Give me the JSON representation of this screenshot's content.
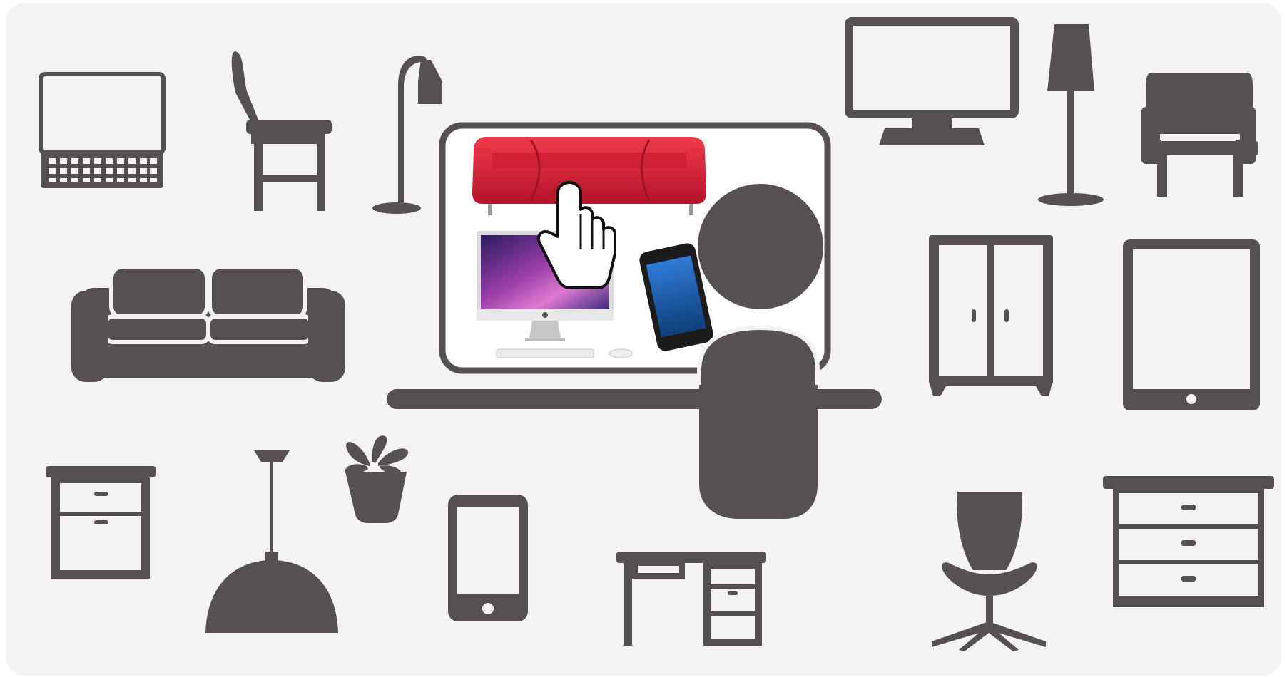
{
  "palette": {
    "background": "#f3f3f3",
    "icon_fill": "#565150",
    "sofa_red": "#d81f33",
    "screen_white": "#ffffff"
  },
  "icons": [
    "laptop-icon",
    "chair-icon",
    "floor-lamp-icon",
    "tv-monitor-icon",
    "tall-floor-lamp-icon",
    "armchair-icon",
    "sofa-icon",
    "wardrobe-icon",
    "tablet-icon",
    "nightstand-icon",
    "pendant-lamp-icon",
    "potted-plant-icon",
    "smartphone-icon",
    "desk-icon",
    "office-chair-icon",
    "dresser-icon",
    "online-shopper-icon",
    "pointer-hand-icon",
    "red-sofa-photo",
    "desktop-computer-photo",
    "iphone-photo"
  ]
}
